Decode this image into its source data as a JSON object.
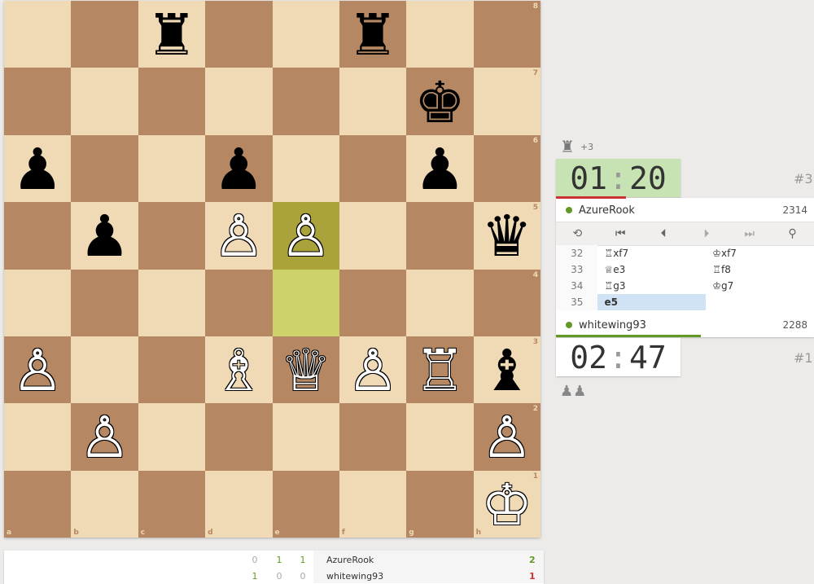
{
  "board": {
    "files": [
      "a",
      "b",
      "c",
      "d",
      "e",
      "f",
      "g",
      "h"
    ],
    "ranks": [
      "8",
      "7",
      "6",
      "5",
      "4",
      "3",
      "2",
      "1"
    ],
    "last_move": {
      "from": "e4",
      "to": "e5"
    },
    "pieces": {
      "c8": {
        "glyph": "♜",
        "color": "b",
        "name": "black-rook"
      },
      "f8": {
        "glyph": "♜",
        "color": "b",
        "name": "black-rook"
      },
      "g7": {
        "glyph": "♚",
        "color": "b",
        "name": "black-king"
      },
      "a6": {
        "glyph": "♟",
        "color": "b",
        "name": "black-pawn"
      },
      "d6": {
        "glyph": "♟",
        "color": "b",
        "name": "black-pawn"
      },
      "g6": {
        "glyph": "♟",
        "color": "b",
        "name": "black-pawn"
      },
      "b5": {
        "glyph": "♟",
        "color": "b",
        "name": "black-pawn"
      },
      "d5": {
        "glyph": "♙",
        "color": "w",
        "name": "white-pawn"
      },
      "e5": {
        "glyph": "♙",
        "color": "w",
        "name": "white-pawn"
      },
      "h5": {
        "glyph": "♛",
        "color": "b",
        "name": "black-queen"
      },
      "a3": {
        "glyph": "♙",
        "color": "w",
        "name": "white-pawn"
      },
      "d3": {
        "glyph": "♗",
        "color": "w",
        "name": "white-bishop"
      },
      "e3": {
        "glyph": "♕",
        "color": "w",
        "name": "white-queen"
      },
      "f3": {
        "glyph": "♙",
        "color": "w",
        "name": "white-pawn"
      },
      "g3": {
        "glyph": "♖",
        "color": "w",
        "name": "white-rook"
      },
      "h3": {
        "glyph": "♝",
        "color": "b",
        "name": "black-bishop"
      },
      "b2": {
        "glyph": "♙",
        "color": "w",
        "name": "white-pawn"
      },
      "h2": {
        "glyph": "♙",
        "color": "w",
        "name": "white-pawn"
      },
      "h1": {
        "glyph": "♔",
        "color": "w",
        "name": "white-king"
      }
    }
  },
  "top_material": {
    "piece": "♜",
    "score": "+3"
  },
  "bottom_material": {
    "pieces": "♟♟"
  },
  "top_clock": {
    "minutes": "01",
    "seconds": "20",
    "sep": ":",
    "rank": "#3",
    "running": true
  },
  "bottom_clock": {
    "minutes": "02",
    "seconds": "47",
    "sep": ":",
    "rank": "#1",
    "running": false
  },
  "top_player": {
    "name": "AzureRook",
    "rating": "2314"
  },
  "bottom_player": {
    "name": "whitewing93",
    "rating": "2288"
  },
  "controls": {
    "flip": "⟲",
    "first": "⏮",
    "prev": "⏴",
    "next": "⏵",
    "last": "⏭",
    "analysis": "⚲"
  },
  "moves": [
    {
      "no": "32",
      "white": "♖xf7",
      "black": "♔xf7"
    },
    {
      "no": "33",
      "white": "♕e3",
      "black": "♖f8"
    },
    {
      "no": "34",
      "white": "♖g3",
      "black": "♔g7"
    },
    {
      "no": "35",
      "white": "e5",
      "black": ""
    }
  ],
  "crosstable": {
    "rows": [
      {
        "results": [
          "0",
          "1",
          "1"
        ],
        "name": "AzureRook",
        "score": "2"
      },
      {
        "results": [
          "1",
          "0",
          "0"
        ],
        "name": "whitewing93",
        "score": "1"
      }
    ]
  },
  "colors": {
    "light": "#f0d9b5",
    "dark": "#b58863",
    "win": "#629924",
    "loss": "#cc3333",
    "running_clock": "#c7e3b3"
  }
}
